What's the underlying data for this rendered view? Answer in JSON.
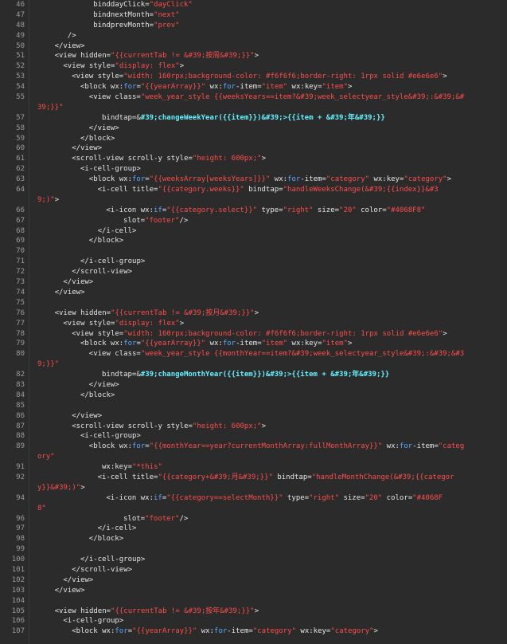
{
  "editor": {
    "theme": {
      "background": "#2b2b2b",
      "text": "#e6e6e6",
      "string": "#ff4d4d",
      "keyword": "#5aa9ff",
      "highlight": "#65f0ff",
      "gutter_text": "#9a9a9a"
    },
    "lines": [
      {
        "n": "46",
        "i": 13,
        "s": [
          {
            "t": "binddayClick="
          },
          {
            "t": "\"dayClick\"",
            "c": "str"
          }
        ]
      },
      {
        "n": "47",
        "i": 13,
        "s": [
          {
            "t": "bindnextMonth="
          },
          {
            "t": "\"next\"",
            "c": "str"
          }
        ]
      },
      {
        "n": "48",
        "i": 13,
        "s": [
          {
            "t": "bindprevMonth="
          },
          {
            "t": "\"prev\"",
            "c": "str"
          }
        ]
      },
      {
        "n": "49",
        "i": 7,
        "s": [
          {
            "t": "/>"
          }
        ]
      },
      {
        "n": "50",
        "i": 4,
        "s": [
          {
            "t": "</view>"
          }
        ]
      },
      {
        "n": "51",
        "i": 4,
        "s": [
          {
            "t": "<view hidden="
          },
          {
            "t": "\"{{currentTab != &#39;按周&#39;}}\"",
            "c": "str"
          },
          {
            "t": ">"
          }
        ]
      },
      {
        "n": "52",
        "i": 6,
        "s": [
          {
            "t": "<view style="
          },
          {
            "t": "\"display: flex\"",
            "c": "str"
          },
          {
            "t": ">"
          }
        ]
      },
      {
        "n": "53",
        "i": 8,
        "s": [
          {
            "t": "<view style="
          },
          {
            "t": "\"width: 160rpx;background-color: #f6f6f6;border-right: 1rpx solid #e6e6e6\"",
            "c": "str"
          },
          {
            "t": ">"
          }
        ]
      },
      {
        "n": "54",
        "i": 10,
        "s": [
          {
            "t": "<block wx:"
          },
          {
            "t": "for",
            "c": "kw"
          },
          {
            "t": "="
          },
          {
            "t": "\"{{yearArray}}\"",
            "c": "str"
          },
          {
            "t": " wx:"
          },
          {
            "t": "for",
            "c": "kw"
          },
          {
            "t": "-item="
          },
          {
            "t": "\"item\"",
            "c": "str"
          },
          {
            "t": " wx:key="
          },
          {
            "t": "\"item\"",
            "c": "str"
          },
          {
            "t": ">"
          }
        ]
      },
      {
        "n": "55",
        "i": 12,
        "s": [
          {
            "t": "<view class="
          },
          {
            "t": "\"week_year_style {{weeksYears==item?&#39;week_selectyear_style&#39;:&#39;&#",
            "c": "str"
          }
        ]
      },
      {
        "n": "",
        "i": 0,
        "s": [
          {
            "t": "39;}}\"",
            "c": "str"
          }
        ]
      },
      {
        "n": "57",
        "i": 15,
        "s": [
          {
            "t": "bindtap=&"
          },
          {
            "t": "#39;changeWeekYear({{item}})&#39;>{{item + &#39;年&#39;}}",
            "c": "cyan"
          }
        ]
      },
      {
        "n": "58",
        "i": 12,
        "s": [
          {
            "t": "</view>"
          }
        ]
      },
      {
        "n": "59",
        "i": 10,
        "s": [
          {
            "t": "</block>"
          }
        ]
      },
      {
        "n": "60",
        "i": 8,
        "s": [
          {
            "t": "</view>"
          }
        ]
      },
      {
        "n": "61",
        "i": 8,
        "s": [
          {
            "t": "<scroll-view scroll-y style="
          },
          {
            "t": "\"height: 600px;\"",
            "c": "str"
          },
          {
            "t": ">"
          }
        ]
      },
      {
        "n": "62",
        "i": 10,
        "s": [
          {
            "t": "<i-cell-group>"
          }
        ]
      },
      {
        "n": "63",
        "i": 12,
        "s": [
          {
            "t": "<block wx:"
          },
          {
            "t": "for",
            "c": "kw"
          },
          {
            "t": "="
          },
          {
            "t": "\"{{weeksArray[weeksYears]}}\"",
            "c": "str"
          },
          {
            "t": " wx:"
          },
          {
            "t": "for",
            "c": "kw"
          },
          {
            "t": "-item="
          },
          {
            "t": "\"category\"",
            "c": "str"
          },
          {
            "t": " wx:key="
          },
          {
            "t": "\"category\"",
            "c": "str"
          },
          {
            "t": ">"
          }
        ]
      },
      {
        "n": "64",
        "i": 14,
        "s": [
          {
            "t": "<i-cell title="
          },
          {
            "t": "\"{{category.weeks}}\"",
            "c": "str"
          },
          {
            "t": " bindtap="
          },
          {
            "t": "\"handleWeeksChange(&#39;{{index}}&#3",
            "c": "str"
          }
        ]
      },
      {
        "n": "",
        "i": 0,
        "s": [
          {
            "t": "9;)\"",
            "c": "str"
          },
          {
            "t": ">"
          }
        ]
      },
      {
        "n": "66",
        "i": 16,
        "s": [
          {
            "t": "<i-icon wx:"
          },
          {
            "t": "if",
            "c": "kw"
          },
          {
            "t": "="
          },
          {
            "t": "\"{{category.select}}\"",
            "c": "str"
          },
          {
            "t": " type="
          },
          {
            "t": "\"right\"",
            "c": "str"
          },
          {
            "t": " size="
          },
          {
            "t": "\"20\"",
            "c": "str"
          },
          {
            "t": " color="
          },
          {
            "t": "\"#4068F8\"",
            "c": "str"
          }
        ]
      },
      {
        "n": "67",
        "i": 20,
        "s": [
          {
            "t": "slot="
          },
          {
            "t": "\"footer\"",
            "c": "str"
          },
          {
            "t": "/>"
          }
        ]
      },
      {
        "n": "68",
        "i": 14,
        "s": [
          {
            "t": "</i-cell>"
          }
        ]
      },
      {
        "n": "69",
        "i": 12,
        "s": [
          {
            "t": "</block>"
          }
        ]
      },
      {
        "n": "70",
        "i": 0,
        "s": []
      },
      {
        "n": "71",
        "i": 10,
        "s": [
          {
            "t": "</i-cell-group>"
          }
        ]
      },
      {
        "n": "72",
        "i": 8,
        "s": [
          {
            "t": "</scroll-view>"
          }
        ]
      },
      {
        "n": "73",
        "i": 6,
        "s": [
          {
            "t": "</view>"
          }
        ]
      },
      {
        "n": "74",
        "i": 4,
        "s": [
          {
            "t": "</view>"
          }
        ]
      },
      {
        "n": "75",
        "i": 0,
        "s": []
      },
      {
        "n": "76",
        "i": 4,
        "s": [
          {
            "t": "<view hidden="
          },
          {
            "t": "\"{{currentTab != &#39;按月&#39;}}\"",
            "c": "str"
          },
          {
            "t": ">"
          }
        ]
      },
      {
        "n": "77",
        "i": 6,
        "s": [
          {
            "t": "<view style="
          },
          {
            "t": "\"display: flex\"",
            "c": "str"
          },
          {
            "t": ">"
          }
        ]
      },
      {
        "n": "78",
        "i": 8,
        "s": [
          {
            "t": "<view style="
          },
          {
            "t": "\"width: 160rpx;background-color: #f6f6f6;border-right: 1rpx solid #e6e6e6\"",
            "c": "str"
          },
          {
            "t": ">"
          }
        ]
      },
      {
        "n": "79",
        "i": 10,
        "s": [
          {
            "t": "<block wx:"
          },
          {
            "t": "for",
            "c": "kw"
          },
          {
            "t": "="
          },
          {
            "t": "\"{{yearArray}}\"",
            "c": "str"
          },
          {
            "t": " wx:"
          },
          {
            "t": "for",
            "c": "kw"
          },
          {
            "t": "-item="
          },
          {
            "t": "\"item\"",
            "c": "str"
          },
          {
            "t": " wx:key="
          },
          {
            "t": "\"item\"",
            "c": "str"
          },
          {
            "t": ">"
          }
        ]
      },
      {
        "n": "80",
        "i": 12,
        "s": [
          {
            "t": "<view class="
          },
          {
            "t": "\"week_year_style {{monthYear==item?&#39;week_selectyear_style&#39;:&#39;&#3",
            "c": "str"
          }
        ]
      },
      {
        "n": "",
        "i": 0,
        "s": [
          {
            "t": "9;}}\"",
            "c": "str"
          }
        ]
      },
      {
        "n": "82",
        "i": 15,
        "s": [
          {
            "t": "bindtap=&"
          },
          {
            "t": "#39;changeMonthYear({{item}})&#39;>{{item + &#39;年&#39;}}",
            "c": "cyan"
          }
        ]
      },
      {
        "n": "83",
        "i": 12,
        "s": [
          {
            "t": "</view>"
          }
        ]
      },
      {
        "n": "84",
        "i": 10,
        "s": [
          {
            "t": "</block>"
          }
        ]
      },
      {
        "n": "85",
        "i": 0,
        "s": []
      },
      {
        "n": "86",
        "i": 8,
        "s": [
          {
            "t": "</view>"
          }
        ]
      },
      {
        "n": "87",
        "i": 8,
        "s": [
          {
            "t": "<scroll-view scroll-y style="
          },
          {
            "t": "\"height: 600px;\"",
            "c": "str"
          },
          {
            "t": ">"
          }
        ]
      },
      {
        "n": "88",
        "i": 10,
        "s": [
          {
            "t": "<i-cell-group>"
          }
        ]
      },
      {
        "n": "89",
        "i": 12,
        "s": [
          {
            "t": "<block wx:"
          },
          {
            "t": "for",
            "c": "kw"
          },
          {
            "t": "="
          },
          {
            "t": "\"{{monthYear==year?currentMonthArray:fullMonthArray}}\"",
            "c": "str"
          },
          {
            "t": " wx:"
          },
          {
            "t": "for",
            "c": "kw"
          },
          {
            "t": "-item="
          },
          {
            "t": "\"categ",
            "c": "str"
          }
        ]
      },
      {
        "n": "",
        "i": 0,
        "s": [
          {
            "t": "ory\"",
            "c": "str"
          }
        ]
      },
      {
        "n": "91",
        "i": 15,
        "s": [
          {
            "t": "wx:key="
          },
          {
            "t": "\"*this\"",
            "c": "str"
          }
        ]
      },
      {
        "n": "92",
        "i": 14,
        "s": [
          {
            "t": "<i-cell title="
          },
          {
            "t": "\"{{category+&#39;月&#39;}}\"",
            "c": "str"
          },
          {
            "t": " bindtap="
          },
          {
            "t": "\"handleMonthChange(&#39;{{categor",
            "c": "str"
          }
        ]
      },
      {
        "n": "",
        "i": 0,
        "s": [
          {
            "t": "y}}&#39;)\"",
            "c": "str"
          },
          {
            "t": ">"
          }
        ]
      },
      {
        "n": "94",
        "i": 16,
        "s": [
          {
            "t": "<i-icon wx:"
          },
          {
            "t": "if",
            "c": "kw"
          },
          {
            "t": "="
          },
          {
            "t": "\"{{category==selectMonth}}\"",
            "c": "str"
          },
          {
            "t": " type="
          },
          {
            "t": "\"right\"",
            "c": "str"
          },
          {
            "t": " size="
          },
          {
            "t": "\"20\"",
            "c": "str"
          },
          {
            "t": " color="
          },
          {
            "t": "\"#4068F",
            "c": "str"
          }
        ]
      },
      {
        "n": "",
        "i": 0,
        "s": [
          {
            "t": "8\"",
            "c": "str"
          }
        ]
      },
      {
        "n": "96",
        "i": 20,
        "s": [
          {
            "t": "slot="
          },
          {
            "t": "\"footer\"",
            "c": "str"
          },
          {
            "t": "/>"
          }
        ]
      },
      {
        "n": "97",
        "i": 14,
        "s": [
          {
            "t": "</i-cell>"
          }
        ]
      },
      {
        "n": "98",
        "i": 12,
        "s": [
          {
            "t": "</block>"
          }
        ]
      },
      {
        "n": "99",
        "i": 0,
        "s": []
      },
      {
        "n": "100",
        "i": 10,
        "s": [
          {
            "t": "</i-cell-group>"
          }
        ]
      },
      {
        "n": "101",
        "i": 8,
        "s": [
          {
            "t": "</scroll-view>"
          }
        ]
      },
      {
        "n": "102",
        "i": 6,
        "s": [
          {
            "t": "</view>"
          }
        ]
      },
      {
        "n": "103",
        "i": 4,
        "s": [
          {
            "t": "</view>"
          }
        ]
      },
      {
        "n": "104",
        "i": 0,
        "s": []
      },
      {
        "n": "105",
        "i": 4,
        "s": [
          {
            "t": "<view hidden="
          },
          {
            "t": "\"{{currentTab != &#39;按年&#39;}}\"",
            "c": "str"
          },
          {
            "t": ">"
          }
        ]
      },
      {
        "n": "106",
        "i": 6,
        "s": [
          {
            "t": "<i-cell-group>"
          }
        ]
      },
      {
        "n": "107",
        "i": 8,
        "s": [
          {
            "t": "<block wx:"
          },
          {
            "t": "for",
            "c": "kw"
          },
          {
            "t": "="
          },
          {
            "t": "\"{{yearArray}}\"",
            "c": "str"
          },
          {
            "t": " wx:"
          },
          {
            "t": "for",
            "c": "kw"
          },
          {
            "t": "-item="
          },
          {
            "t": "\"category\"",
            "c": "str"
          },
          {
            "t": " wx:key="
          },
          {
            "t": "\"category\"",
            "c": "str"
          },
          {
            "t": ">"
          }
        ]
      }
    ]
  }
}
